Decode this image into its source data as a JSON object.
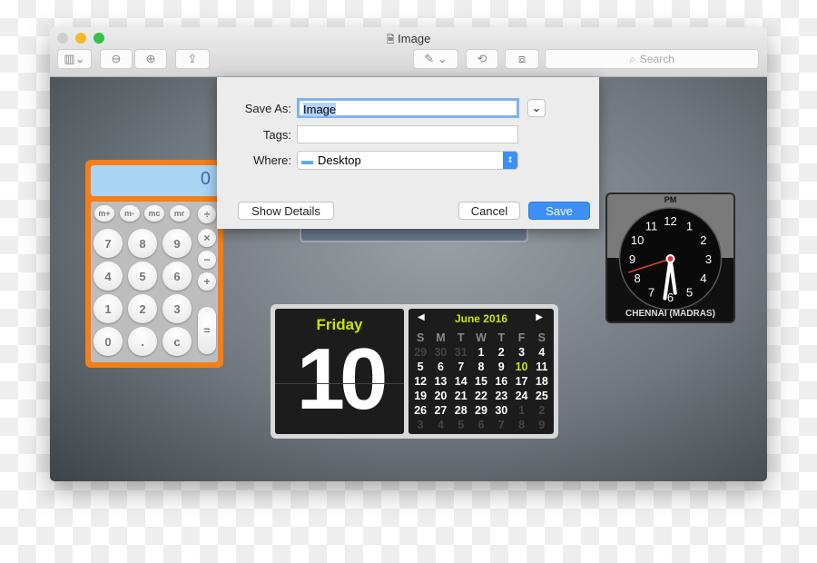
{
  "window": {
    "title": "Image",
    "search_placeholder": "Search"
  },
  "toolbar": {
    "icons": [
      "sidebar-icon",
      "zoom-out-icon",
      "zoom-in-icon",
      "share-icon",
      "markup-pen-icon",
      "rotate-icon",
      "toolbox-icon"
    ]
  },
  "dialog": {
    "save_as_label": "Save As:",
    "save_as_value": "Image",
    "tags_label": "Tags:",
    "tags_value": "",
    "where_label": "Where:",
    "where_value": "Desktop",
    "show_details": "Show Details",
    "cancel": "Cancel",
    "save": "Save",
    "accent": "#3b8ff5"
  },
  "calculator": {
    "display": "0",
    "memory_keys": [
      "m+",
      "m-",
      "mc",
      "mr"
    ],
    "rows": [
      [
        "7",
        "8",
        "9"
      ],
      [
        "4",
        "5",
        "6"
      ],
      [
        "1",
        "2",
        "3"
      ],
      [
        "0",
        ".",
        "c"
      ]
    ],
    "ops": [
      "÷",
      "×",
      "−",
      "+",
      "="
    ]
  },
  "calendar": {
    "weekday": "Friday",
    "day": "10",
    "month": "June 2016",
    "headers": [
      "S",
      "M",
      "T",
      "W",
      "T",
      "F",
      "S"
    ],
    "days": [
      "29",
      "30",
      "31",
      "1",
      "2",
      "3",
      "4",
      "5",
      "6",
      "7",
      "8",
      "9",
      "10",
      "11",
      "12",
      "13",
      "14",
      "15",
      "16",
      "17",
      "18",
      "19",
      "20",
      "21",
      "22",
      "23",
      "24",
      "25",
      "26",
      "27",
      "28",
      "29",
      "30",
      "1",
      "2",
      "3",
      "4",
      "5",
      "6",
      "7",
      "8",
      "9"
    ],
    "today": "10",
    "highlight": "#c8e600"
  },
  "clock": {
    "ampm": "PM",
    "city": "CHENNAI (MADRAS)",
    "numbers": [
      "12",
      "1",
      "2",
      "3",
      "4",
      "5",
      "6",
      "7",
      "8",
      "9",
      "10",
      "11"
    ]
  }
}
